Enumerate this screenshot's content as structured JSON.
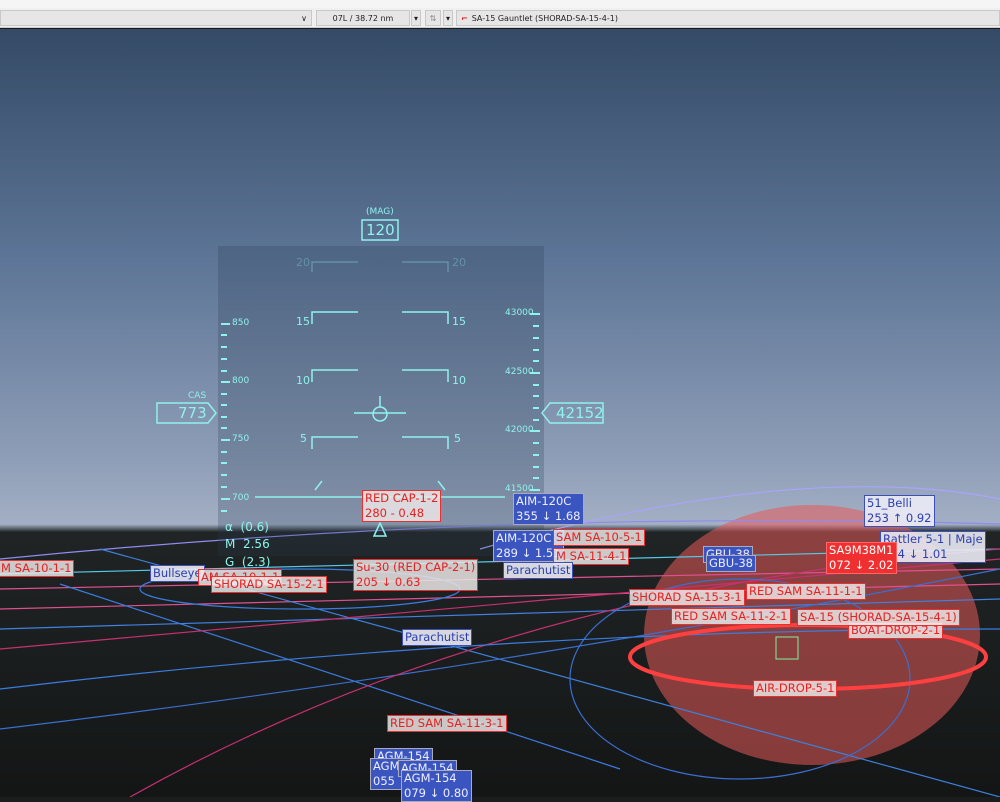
{
  "toolbar": {
    "range": "07L / 38.72 nm",
    "target": "SA-15 Gauntlet (SHORAD-SA-15-4-1)",
    "dropdown": "∨"
  },
  "hud": {
    "heading_label": "(MAG)",
    "heading": "120",
    "cas_label": "CAS",
    "cas": "773",
    "altitude": "42152",
    "speed_ticks": [
      "850",
      "800",
      "750",
      "700"
    ],
    "alt_ticks": [
      "43000",
      "42500",
      "42000",
      "41500"
    ],
    "pitch": [
      "20",
      "15",
      "10",
      "5"
    ],
    "alpha": "α  (0.6)",
    "mach": "M  2.56",
    "g": "G  (2.3)"
  },
  "labels": [
    {
      "text": "RED CAP-1-2\n280 - 0.48",
      "style": "red"
    },
    {
      "text": "AIM-120C\n355 ↓ 1.68",
      "style": "bluef"
    },
    {
      "text": "AIM-120C\n289 ↓ 1.51",
      "style": "bluef"
    },
    {
      "text": "SAM SA-10-5-1",
      "style": "red"
    },
    {
      "text": "M SA-11-4-1",
      "style": "red"
    },
    {
      "text": "Parachutist",
      "style": "blue"
    },
    {
      "text": "Su-30 (RED CAP-2-1)\n205 ↓ 0.63",
      "style": "red"
    },
    {
      "text": "M SA-10-1-1",
      "style": "red"
    },
    {
      "text": "Bullseye",
      "style": "blue"
    },
    {
      "text": "AM SA-10-1-1",
      "style": "red"
    },
    {
      "text": "SHORAD SA-15-2-1",
      "style": "red"
    },
    {
      "text": "Parachutist",
      "style": "blue"
    },
    {
      "text": "RED SAM SA-11-3-1",
      "style": "red"
    },
    {
      "text": "AGM-154",
      "style": "bluef"
    },
    {
      "text": "AGM\n055 ↓",
      "style": "bluef"
    },
    {
      "text": "AGM-154",
      "style": "bluef"
    },
    {
      "text": "AGM-154\n079 ↓ 0.80",
      "style": "bluef"
    },
    {
      "text": "51_Belli\n253 ↑ 0.92",
      "style": "blue"
    },
    {
      "text": "Rattler 5-1 | Maje\n084 ↓ 1.01",
      "style": "blue"
    },
    {
      "text": "GBU-38",
      "style": "bluef"
    },
    {
      "text": "GBU-38",
      "style": "bluef"
    },
    {
      "text": "SA9M38M1\n072 ↓ 2.02",
      "style": "redf"
    },
    {
      "text": "SHORAD SA-15-3-1",
      "style": "red"
    },
    {
      "text": "RED SAM SA-11-1-1",
      "style": "red"
    },
    {
      "text": "RED SAM SA-11-2-1",
      "style": "red"
    },
    {
      "text": "BOAT-DROP-2-1",
      "style": "red"
    },
    {
      "text": "SA-15 (SHORAD-SA-15-4-1)",
      "style": "red"
    },
    {
      "text": "AIR-DROP-5-1",
      "style": "red"
    }
  ]
}
